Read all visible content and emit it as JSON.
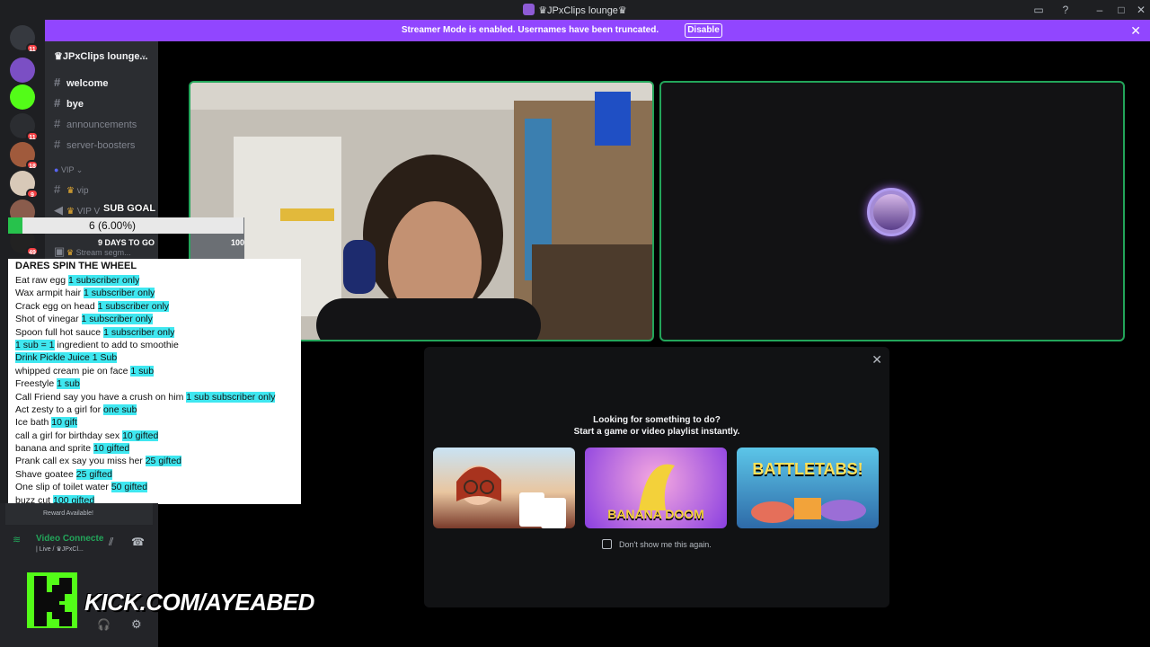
{
  "window": {
    "title": "♛JPxClips lounge♛"
  },
  "banner": {
    "message": "Streamer Mode is enabled. Usernames have been truncated.",
    "disable_label": "Disable"
  },
  "servers": [
    {
      "badge": "11",
      "color": "#36393f"
    },
    {
      "badge": "",
      "color": "#7b4fc4"
    },
    {
      "badge": "",
      "color": "#53fc18"
    },
    {
      "badge": "11",
      "color": "#2b2d31"
    },
    {
      "badge": "18",
      "color": "#a05a3c"
    },
    {
      "badge": "9",
      "color": "#d8c9b8"
    },
    {
      "badge": "",
      "color": "#8a5c4c"
    },
    {
      "badge": "49",
      "color": "#222222"
    }
  ],
  "sidebar": {
    "guild_name": "♛JPxClips lounge...",
    "channels": [
      {
        "name": "welcome",
        "unread": true
      },
      {
        "name": "bye",
        "unread": true
      },
      {
        "name": "announcements",
        "unread": false
      },
      {
        "name": "server-boosters",
        "unread": false
      }
    ],
    "category": "VIP",
    "vip_channel": "vip",
    "voice_channel": "VIP V",
    "stage_channel": "Stream segm..."
  },
  "sub_goal": {
    "label": "SUB GOAL",
    "count_text": "6 (6.00%)",
    "progress_fraction": 0.06,
    "days_text": "9 DAYS TO GO",
    "target": "100"
  },
  "dares": {
    "header": "DARES SPIN THE WHEEL",
    "items": [
      {
        "text": "Eat raw egg ",
        "tag": "1 subscriber only"
      },
      {
        "text": "Wax armpit hair ",
        "tag": "1 subscriber only"
      },
      {
        "text": "Crack egg on head ",
        "tag": "1 subscriber only"
      },
      {
        "text": "Shot of vinegar ",
        "tag": "1 subscriber only"
      },
      {
        "text": " Spoon full hot sauce ",
        "tag": "1 subscriber only"
      },
      {
        "text": "",
        "tag": "1 sub = 1",
        "suffix": " ingredient to add to smoothie"
      },
      {
        "text": "",
        "tag": "Drink Pickle Juice 1 Sub"
      },
      {
        "text": "whipped cream pie on face ",
        "tag": "1 sub"
      },
      {
        "text": "Freestyle ",
        "tag": "1 sub"
      },
      {
        "text": "Call Friend say you have a crush on him ",
        "tag": "1 sub subscriber only"
      },
      {
        "text": "Act zesty to a girl for ",
        "tag": "one sub"
      },
      {
        "text": "Ice bath ",
        "tag": "10 gift"
      },
      {
        "text": "call a girl for birthday sex ",
        "tag": "10 gifted"
      },
      {
        "text": " banana and sprite ",
        "tag": "10 gifted"
      },
      {
        "text": "Prank call ex say you miss her ",
        "tag": "25 gifted"
      },
      {
        "text": "Shave goatee ",
        "tag": "25 gifted"
      },
      {
        "text": "One slip of toilet water ",
        "tag": "50 gifted"
      },
      {
        "text": "buzz cut ",
        "tag": "100 gifted"
      }
    ]
  },
  "activity": {
    "line1": "Looking for something to do?",
    "line2": "Start a game or video playlist instantly.",
    "games": [
      {
        "title": "",
        "color_a": "#c9e3f4",
        "color_b": "#7a3b2b"
      },
      {
        "title": "BANANA DOOM",
        "color_a": "#8a3fe0",
        "color_b": "#f3d13a"
      },
      {
        "title": "BATTLETABS!",
        "color_a": "#5cc6e8",
        "color_b": "#2e6aa8"
      }
    ],
    "dont_show": "Don't show me this again."
  },
  "voice_panel": {
    "reward": "Reward Available!",
    "status": "Video Connecte",
    "subtitle": "| Live / ♛JPxCl..."
  },
  "overlay": {
    "url_text": "KICK.COM/AYEABED"
  },
  "colors": {
    "accent": "#9146ff",
    "speaking": "#23a55a",
    "highlight": "#3fe7f0",
    "kick": "#53fc18"
  }
}
